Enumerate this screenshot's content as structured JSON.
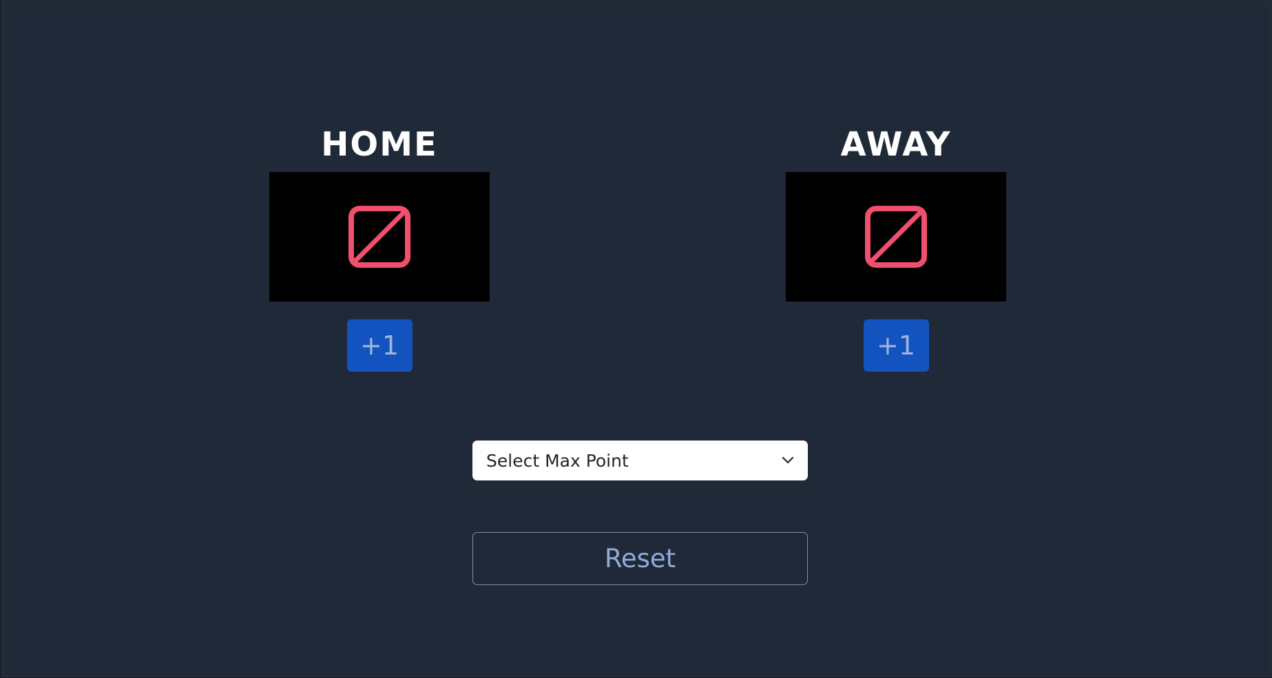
{
  "home": {
    "title": "HOME",
    "score_icon": "broken-image-icon",
    "add_label": "+1"
  },
  "away": {
    "title": "AWAY",
    "score_icon": "broken-image-icon",
    "add_label": "+1"
  },
  "max_point_select": {
    "selected_label": "Select Max Point",
    "icon": "chevron-down-icon"
  },
  "reset": {
    "label": "Reset"
  },
  "colors": {
    "background": "#202938",
    "button_primary": "#1353c0",
    "icon_accent": "#f0506e",
    "reset_text": "#93aad8"
  }
}
